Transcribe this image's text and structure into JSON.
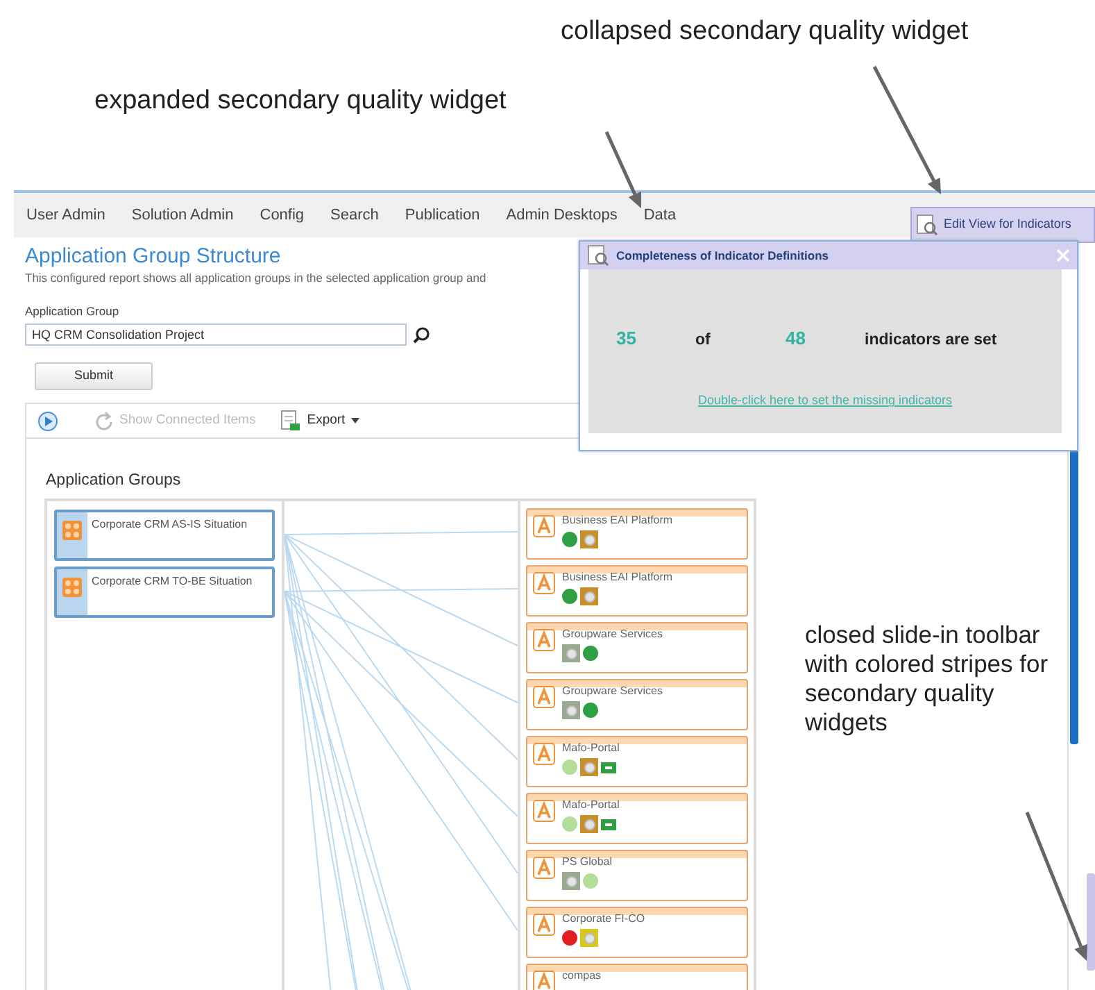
{
  "annotations": [
    {
      "text": "collapsed secondary quality widget"
    },
    {
      "text": "expanded secondary quality widget"
    },
    {
      "text": "closed slide-in toolbar with colored stripes for secondary quality widgets"
    }
  ],
  "menu": {
    "items": [
      "User Admin",
      "Solution Admin",
      "Config",
      "Search",
      "Publication",
      "Admin Desktops",
      "Data"
    ]
  },
  "edit_view_button": {
    "label": "Edit View for Indicators"
  },
  "page": {
    "title": "Application Group Structure",
    "description": "This configured report shows all application groups in the selected application group and",
    "field_label": "Application Group",
    "field_value": "HQ CRM Consolidation Project",
    "submit": "Submit"
  },
  "toolbar": {
    "show_connected": {
      "label": "Show Connected Items",
      "disabled": true
    },
    "export": "Export"
  },
  "diagram": {
    "title": "Application Groups",
    "groups": [
      {
        "name": "Corporate CRM AS-IS Situation"
      },
      {
        "name": "Corporate CRM TO-BE Situation"
      }
    ],
    "applications": [
      {
        "name": "Business EAI Platform",
        "indicators": [
          {
            "kind": "dot",
            "color": "#2ea043"
          },
          {
            "kind": "square",
            "color": "#c8902a"
          }
        ]
      },
      {
        "name": "Business EAI Platform",
        "indicators": [
          {
            "kind": "dot",
            "color": "#2ea043"
          },
          {
            "kind": "square",
            "color": "#c8902a"
          }
        ]
      },
      {
        "name": "Groupware Services",
        "indicators": [
          {
            "kind": "square",
            "color": "#9aaa90"
          },
          {
            "kind": "dot",
            "color": "#2ea043"
          }
        ]
      },
      {
        "name": "Groupware Services",
        "indicators": [
          {
            "kind": "square",
            "color": "#9aaa90"
          },
          {
            "kind": "dot",
            "color": "#2ea043"
          }
        ]
      },
      {
        "name": "Mafo-Portal",
        "indicators": [
          {
            "kind": "dot",
            "color": "#b5dd9a"
          },
          {
            "kind": "square",
            "color": "#c8902a"
          },
          {
            "kind": "tag",
            "color": "#2ea043"
          }
        ]
      },
      {
        "name": "Mafo-Portal",
        "indicators": [
          {
            "kind": "dot",
            "color": "#b5dd9a"
          },
          {
            "kind": "square",
            "color": "#c8902a"
          },
          {
            "kind": "tag",
            "color": "#2ea043"
          }
        ]
      },
      {
        "name": "PS Global",
        "indicators": [
          {
            "kind": "square",
            "color": "#9aaa90"
          },
          {
            "kind": "dot",
            "color": "#b5dd9a"
          }
        ]
      },
      {
        "name": "Corporate FI-CO",
        "indicators": [
          {
            "kind": "dot",
            "color": "#e02020"
          },
          {
            "kind": "square",
            "color": "#d6c81e"
          }
        ]
      },
      {
        "name": "compas"
      }
    ]
  },
  "widget": {
    "title": "Completeness of Indicator Definitions",
    "count_set": "35",
    "of": "of",
    "count_total": "48",
    "suffix": "indicators are set",
    "link": "Double-click here to set the missing indicators"
  },
  "slide_in_toolbar": {
    "stripes": [
      {
        "color": "#1a6fc4"
      },
      {
        "color": "#c9c5ea"
      }
    ]
  }
}
